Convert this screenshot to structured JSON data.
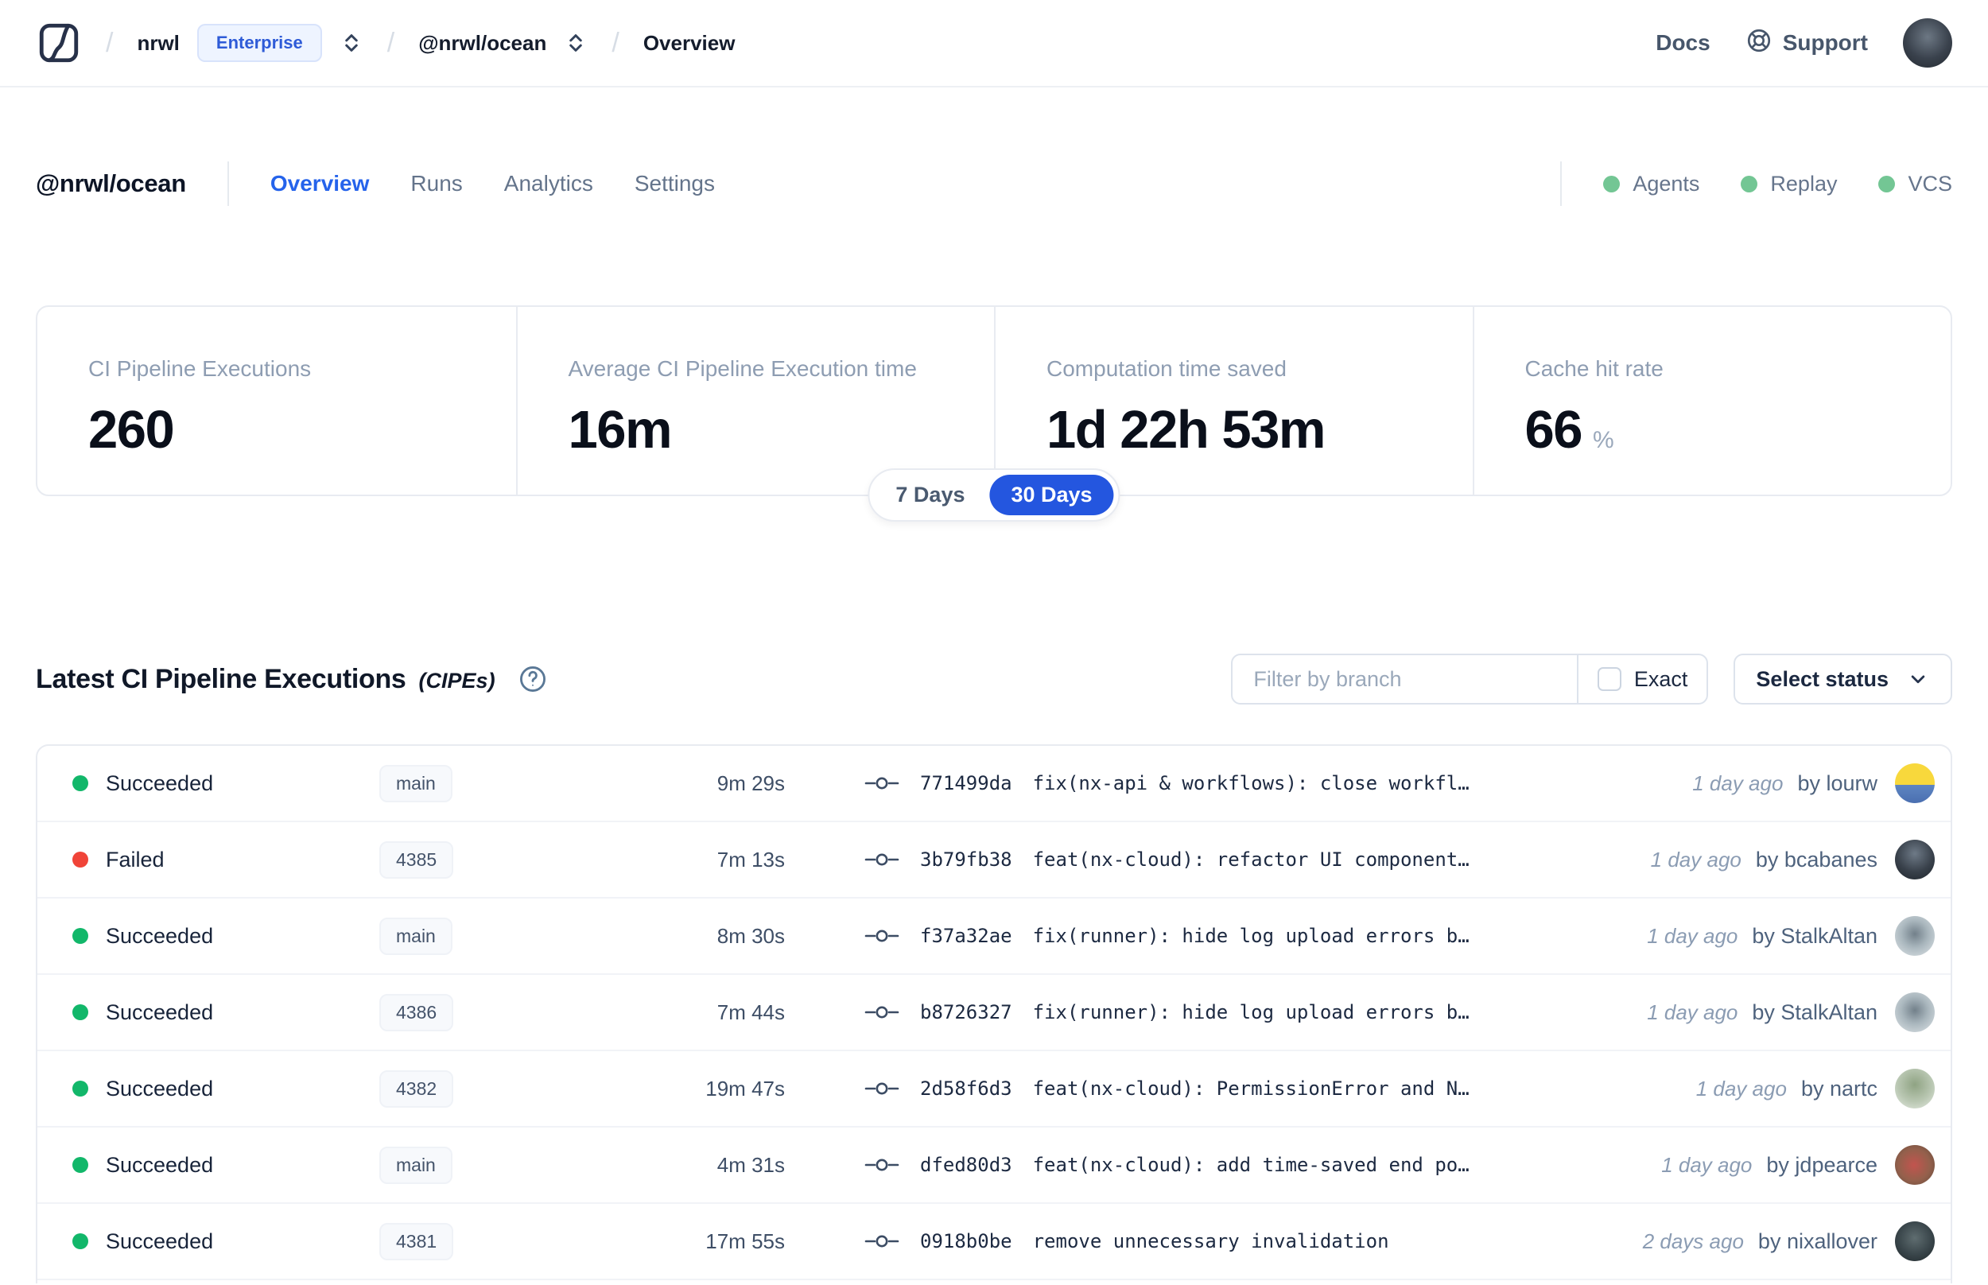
{
  "topbar": {
    "breadcrumb": {
      "separator": "/",
      "org": "nrwl",
      "org_badge": "Enterprise",
      "workspace": "@nrwl/ocean",
      "page": "Overview"
    },
    "docs_label": "Docs",
    "support_label": "Support",
    "avatar_bg": "radial-gradient(circle at 50% 38%, #6d7884 0%, #3a424d 55%, #232930 100%)"
  },
  "workspace": {
    "title": "@nrwl/ocean",
    "tabs": [
      {
        "label": "Overview",
        "active": true
      },
      {
        "label": "Runs",
        "active": false
      },
      {
        "label": "Analytics",
        "active": false
      },
      {
        "label": "Settings",
        "active": false
      }
    ],
    "features": [
      {
        "label": "Agents"
      },
      {
        "label": "Replay"
      },
      {
        "label": "VCS"
      }
    ],
    "feature_dot_color": "#73c694"
  },
  "stats": {
    "cards": [
      {
        "label": "CI Pipeline Executions",
        "value": "260",
        "unit": ""
      },
      {
        "label": "Average CI Pipeline Execution time",
        "value": "16m",
        "unit": ""
      },
      {
        "label": "Computation time saved",
        "value": "1d 22h 53m",
        "unit": ""
      },
      {
        "label": "Cache hit rate",
        "value": "66",
        "unit": "%"
      }
    ],
    "range_toggle": {
      "options": [
        "7 Days",
        "30 Days"
      ],
      "selected": "30 Days"
    }
  },
  "cipes": {
    "title": "Latest CI Pipeline Executions",
    "title_suffix": "(CIPEs)",
    "filter_placeholder": "Filter by branch",
    "exact_label": "Exact",
    "select_status_label": "Select status",
    "rows": [
      {
        "status": "Succeeded",
        "status_color": "#12b76a",
        "branch": "main",
        "duration": "9m 29s",
        "commit_hash": "771499da",
        "commit_message": "fix(nx-api & workflows): close workfl…",
        "time_ago": "1 day ago",
        "author": "by lourw",
        "avatar_bg": "linear-gradient(180deg,#f8d83c 0%,#f8d83c 54%,#5e86c2 54%,#4a6fb0 100%)"
      },
      {
        "status": "Failed",
        "status_color": "#f04438",
        "branch": "4385",
        "duration": "7m 13s",
        "commit_hash": "3b79fb38",
        "commit_message": "feat(nx-cloud): refactor UI component…",
        "time_ago": "1 day ago",
        "author": "by bcabanes",
        "avatar_bg": "radial-gradient(circle at 50% 35%,#6e7a87 0%,#39414b 55%,#1e242b 100%)"
      },
      {
        "status": "Succeeded",
        "status_color": "#12b76a",
        "branch": "main",
        "duration": "8m 30s",
        "commit_hash": "f37a32ae",
        "commit_message": "fix(runner): hide log upload errors b…",
        "time_ago": "1 day ago",
        "author": "by StalkAltan",
        "avatar_bg": "radial-gradient(circle at 50% 45%,#72808a 0%,#a9b6bd 45%,#dfe5e8 100%)"
      },
      {
        "status": "Succeeded",
        "status_color": "#12b76a",
        "branch": "4386",
        "duration": "7m 44s",
        "commit_hash": "b8726327",
        "commit_message": "fix(runner): hide log upload errors b…",
        "time_ago": "1 day ago",
        "author": "by StalkAltan",
        "avatar_bg": "radial-gradient(circle at 50% 45%,#72808a 0%,#a9b6bd 45%,#dfe5e8 100%)"
      },
      {
        "status": "Succeeded",
        "status_color": "#12b76a",
        "branch": "4382",
        "duration": "19m 47s",
        "commit_hash": "2d58f6d3",
        "commit_message": "feat(nx-cloud): PermissionError and N…",
        "time_ago": "1 day ago",
        "author": "by nartc",
        "avatar_bg": "radial-gradient(circle at 50% 40%,#8fa383 0%,#b9c7b2 55%,#e6ebe3 100%)"
      },
      {
        "status": "Succeeded",
        "status_color": "#12b76a",
        "branch": "main",
        "duration": "4m 31s",
        "commit_hash": "dfed80d3",
        "commit_message": "feat(nx-cloud): add time-saved end po…",
        "time_ago": "1 day ago",
        "author": "by jdpearce",
        "avatar_bg": "radial-gradient(circle at 48% 50%,#c2544e 0%,#94604c 55%,#63493a 100%)"
      },
      {
        "status": "Succeeded",
        "status_color": "#12b76a",
        "branch": "4381",
        "duration": "17m 55s",
        "commit_hash": "0918b0be",
        "commit_message": "remove unnecessary invalidation",
        "time_ago": "2 days ago",
        "author": "by nixallover",
        "avatar_bg": "radial-gradient(circle at 50% 42%,#5f6d70 0%,#39454a 55%,#20282b 100%)"
      }
    ]
  },
  "colors": {
    "accent": "#2563eb",
    "success": "#12b76a",
    "failure": "#f04438"
  }
}
